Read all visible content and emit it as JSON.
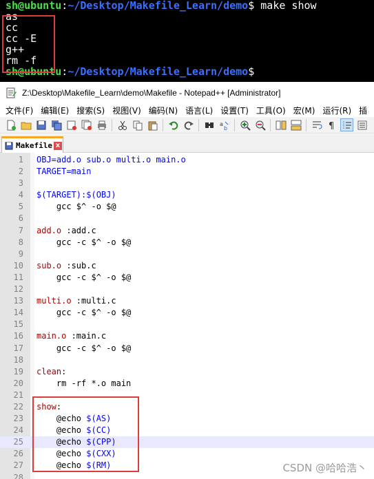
{
  "terminal": {
    "prompt_user": "sh@ubuntu",
    "prompt_sep": ":",
    "prompt_path": "~/Desktop/Makefile_Learn/demo",
    "prompt_symbol": "$",
    "command": " make show",
    "output": [
      "as",
      "cc",
      "cc -E",
      "g++",
      "rm -f"
    ]
  },
  "window": {
    "title": "Z:\\Desktop\\Makefile_Learn\\demo\\Makefile - Notepad++ [Administrator]"
  },
  "menu": [
    "文件(F)",
    "编辑(E)",
    "搜索(S)",
    "视图(V)",
    "编码(N)",
    "语言(L)",
    "设置(T)",
    "工具(O)",
    "宏(M)",
    "运行(R)",
    "插"
  ],
  "toolbar_icons": [
    "new-file-icon",
    "open-file-icon",
    "save-icon",
    "save-all-icon",
    "close-icon",
    "close-all-icon",
    "print-icon",
    "cut-icon",
    "copy-icon",
    "paste-icon",
    "undo-icon",
    "redo-icon",
    "find-icon",
    "replace-icon",
    "zoom-in-icon",
    "zoom-out-icon",
    "sync-v-icon",
    "sync-h-icon",
    "word-wrap-icon",
    "show-all-chars-icon",
    "indent-guide-icon",
    "function-list-icon"
  ],
  "tab": {
    "label": "Makefile",
    "close": "x"
  },
  "code": [
    {
      "n": "1",
      "tokens": [
        {
          "t": "OBJ=add.o sub.o multi.o main.o",
          "c": "var"
        }
      ]
    },
    {
      "n": "2",
      "tokens": [
        {
          "t": "TARGET=main",
          "c": "var"
        }
      ]
    },
    {
      "n": "3",
      "tokens": []
    },
    {
      "n": "4",
      "tokens": [
        {
          "t": "$(TARGET):$(OBJ)",
          "c": "var"
        }
      ]
    },
    {
      "n": "5",
      "tokens": [
        {
          "t": "    gcc $^ -o $@",
          "c": "cmd"
        }
      ]
    },
    {
      "n": "6",
      "tokens": []
    },
    {
      "n": "7",
      "tokens": [
        {
          "t": "add.o",
          "c": "target"
        },
        {
          "t": " :add.c",
          "c": "cmd"
        }
      ]
    },
    {
      "n": "8",
      "tokens": [
        {
          "t": "    gcc -c $^ -o $@",
          "c": "cmd"
        }
      ]
    },
    {
      "n": "9",
      "tokens": []
    },
    {
      "n": "10",
      "tokens": [
        {
          "t": "sub.o",
          "c": "target"
        },
        {
          "t": " :sub.c",
          "c": "cmd"
        }
      ]
    },
    {
      "n": "11",
      "tokens": [
        {
          "t": "    gcc -c $^ -o $@",
          "c": "cmd"
        }
      ]
    },
    {
      "n": "12",
      "tokens": []
    },
    {
      "n": "13",
      "tokens": [
        {
          "t": "multi.o",
          "c": "target"
        },
        {
          "t": " :multi.c",
          "c": "cmd"
        }
      ]
    },
    {
      "n": "14",
      "tokens": [
        {
          "t": "    gcc -c $^ -o $@",
          "c": "cmd"
        }
      ]
    },
    {
      "n": "15",
      "tokens": []
    },
    {
      "n": "16",
      "tokens": [
        {
          "t": "main.o",
          "c": "target"
        },
        {
          "t": " :main.c",
          "c": "cmd"
        }
      ]
    },
    {
      "n": "17",
      "tokens": [
        {
          "t": "    gcc -c $^ -o $@",
          "c": "cmd"
        }
      ]
    },
    {
      "n": "18",
      "tokens": []
    },
    {
      "n": "19",
      "tokens": [
        {
          "t": "clean",
          "c": "target"
        },
        {
          "t": ":",
          "c": "cmd"
        }
      ]
    },
    {
      "n": "20",
      "tokens": [
        {
          "t": "    rm -rf *.o main",
          "c": "cmd"
        }
      ]
    },
    {
      "n": "21",
      "tokens": []
    },
    {
      "n": "22",
      "tokens": [
        {
          "t": "show",
          "c": "target"
        },
        {
          "t": ":",
          "c": "cmd"
        }
      ]
    },
    {
      "n": "23",
      "tokens": [
        {
          "t": "    @echo ",
          "c": "cmd"
        },
        {
          "t": "$(AS)",
          "c": "var"
        }
      ]
    },
    {
      "n": "24",
      "tokens": [
        {
          "t": "    @echo ",
          "c": "cmd"
        },
        {
          "t": "$(CC)",
          "c": "var"
        }
      ]
    },
    {
      "n": "25",
      "tokens": [
        {
          "t": "    @echo ",
          "c": "cmd"
        },
        {
          "t": "$(CPP)",
          "c": "var"
        }
      ],
      "current": true
    },
    {
      "n": "26",
      "tokens": [
        {
          "t": "    @echo ",
          "c": "cmd"
        },
        {
          "t": "$(CXX)",
          "c": "var"
        }
      ]
    },
    {
      "n": "27",
      "tokens": [
        {
          "t": "    @echo ",
          "c": "cmd"
        },
        {
          "t": "$(RM)",
          "c": "var"
        }
      ]
    },
    {
      "n": "28",
      "tokens": []
    }
  ],
  "watermark": "CSDN @哈哈浩丶",
  "colors": {
    "prompt_user": "#4ce04c",
    "prompt_path": "#3b6fff",
    "highlight_box": "#e03b3b",
    "var": "#0000ff",
    "target": "#b00000"
  }
}
